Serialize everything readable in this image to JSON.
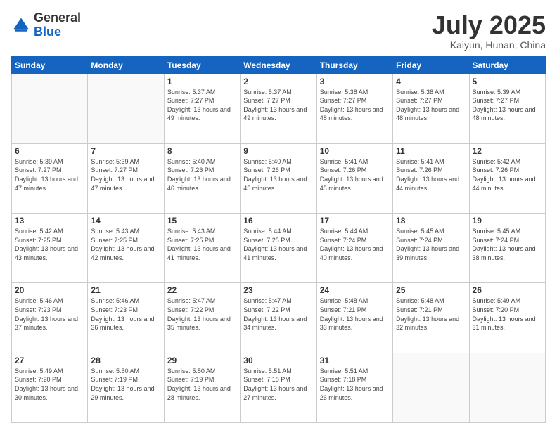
{
  "header": {
    "logo_general": "General",
    "logo_blue": "Blue",
    "month_title": "July 2025",
    "location": "Kaiyun, Hunan, China"
  },
  "weekdays": [
    "Sunday",
    "Monday",
    "Tuesday",
    "Wednesday",
    "Thursday",
    "Friday",
    "Saturday"
  ],
  "weeks": [
    [
      {
        "day": "",
        "info": ""
      },
      {
        "day": "",
        "info": ""
      },
      {
        "day": "1",
        "info": "Sunrise: 5:37 AM\nSunset: 7:27 PM\nDaylight: 13 hours and 49 minutes."
      },
      {
        "day": "2",
        "info": "Sunrise: 5:37 AM\nSunset: 7:27 PM\nDaylight: 13 hours and 49 minutes."
      },
      {
        "day": "3",
        "info": "Sunrise: 5:38 AM\nSunset: 7:27 PM\nDaylight: 13 hours and 48 minutes."
      },
      {
        "day": "4",
        "info": "Sunrise: 5:38 AM\nSunset: 7:27 PM\nDaylight: 13 hours and 48 minutes."
      },
      {
        "day": "5",
        "info": "Sunrise: 5:39 AM\nSunset: 7:27 PM\nDaylight: 13 hours and 48 minutes."
      }
    ],
    [
      {
        "day": "6",
        "info": "Sunrise: 5:39 AM\nSunset: 7:27 PM\nDaylight: 13 hours and 47 minutes."
      },
      {
        "day": "7",
        "info": "Sunrise: 5:39 AM\nSunset: 7:27 PM\nDaylight: 13 hours and 47 minutes."
      },
      {
        "day": "8",
        "info": "Sunrise: 5:40 AM\nSunset: 7:26 PM\nDaylight: 13 hours and 46 minutes."
      },
      {
        "day": "9",
        "info": "Sunrise: 5:40 AM\nSunset: 7:26 PM\nDaylight: 13 hours and 45 minutes."
      },
      {
        "day": "10",
        "info": "Sunrise: 5:41 AM\nSunset: 7:26 PM\nDaylight: 13 hours and 45 minutes."
      },
      {
        "day": "11",
        "info": "Sunrise: 5:41 AM\nSunset: 7:26 PM\nDaylight: 13 hours and 44 minutes."
      },
      {
        "day": "12",
        "info": "Sunrise: 5:42 AM\nSunset: 7:26 PM\nDaylight: 13 hours and 44 minutes."
      }
    ],
    [
      {
        "day": "13",
        "info": "Sunrise: 5:42 AM\nSunset: 7:25 PM\nDaylight: 13 hours and 43 minutes."
      },
      {
        "day": "14",
        "info": "Sunrise: 5:43 AM\nSunset: 7:25 PM\nDaylight: 13 hours and 42 minutes."
      },
      {
        "day": "15",
        "info": "Sunrise: 5:43 AM\nSunset: 7:25 PM\nDaylight: 13 hours and 41 minutes."
      },
      {
        "day": "16",
        "info": "Sunrise: 5:44 AM\nSunset: 7:25 PM\nDaylight: 13 hours and 41 minutes."
      },
      {
        "day": "17",
        "info": "Sunrise: 5:44 AM\nSunset: 7:24 PM\nDaylight: 13 hours and 40 minutes."
      },
      {
        "day": "18",
        "info": "Sunrise: 5:45 AM\nSunset: 7:24 PM\nDaylight: 13 hours and 39 minutes."
      },
      {
        "day": "19",
        "info": "Sunrise: 5:45 AM\nSunset: 7:24 PM\nDaylight: 13 hours and 38 minutes."
      }
    ],
    [
      {
        "day": "20",
        "info": "Sunrise: 5:46 AM\nSunset: 7:23 PM\nDaylight: 13 hours and 37 minutes."
      },
      {
        "day": "21",
        "info": "Sunrise: 5:46 AM\nSunset: 7:23 PM\nDaylight: 13 hours and 36 minutes."
      },
      {
        "day": "22",
        "info": "Sunrise: 5:47 AM\nSunset: 7:22 PM\nDaylight: 13 hours and 35 minutes."
      },
      {
        "day": "23",
        "info": "Sunrise: 5:47 AM\nSunset: 7:22 PM\nDaylight: 13 hours and 34 minutes."
      },
      {
        "day": "24",
        "info": "Sunrise: 5:48 AM\nSunset: 7:21 PM\nDaylight: 13 hours and 33 minutes."
      },
      {
        "day": "25",
        "info": "Sunrise: 5:48 AM\nSunset: 7:21 PM\nDaylight: 13 hours and 32 minutes."
      },
      {
        "day": "26",
        "info": "Sunrise: 5:49 AM\nSunset: 7:20 PM\nDaylight: 13 hours and 31 minutes."
      }
    ],
    [
      {
        "day": "27",
        "info": "Sunrise: 5:49 AM\nSunset: 7:20 PM\nDaylight: 13 hours and 30 minutes."
      },
      {
        "day": "28",
        "info": "Sunrise: 5:50 AM\nSunset: 7:19 PM\nDaylight: 13 hours and 29 minutes."
      },
      {
        "day": "29",
        "info": "Sunrise: 5:50 AM\nSunset: 7:19 PM\nDaylight: 13 hours and 28 minutes."
      },
      {
        "day": "30",
        "info": "Sunrise: 5:51 AM\nSunset: 7:18 PM\nDaylight: 13 hours and 27 minutes."
      },
      {
        "day": "31",
        "info": "Sunrise: 5:51 AM\nSunset: 7:18 PM\nDaylight: 13 hours and 26 minutes."
      },
      {
        "day": "",
        "info": ""
      },
      {
        "day": "",
        "info": ""
      }
    ]
  ]
}
